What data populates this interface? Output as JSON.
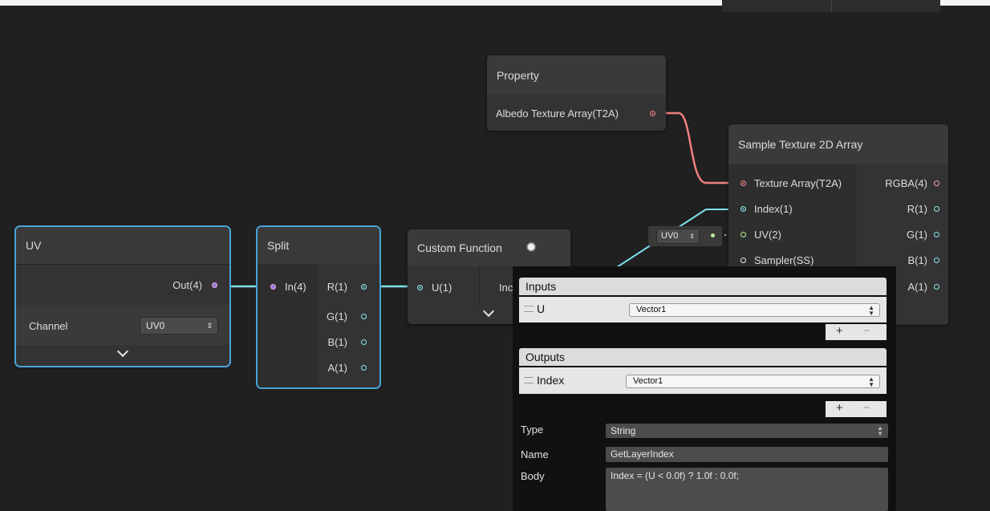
{
  "nodes": {
    "uv": {
      "title": "UV",
      "output": "Out(4)",
      "channel_label": "Channel",
      "channel_value": "UV0"
    },
    "split": {
      "title": "Split",
      "input": "In(4)",
      "outputs": [
        "R(1)",
        "G(1)",
        "B(1)",
        "A(1)"
      ]
    },
    "custom_function": {
      "title": "Custom Function",
      "input": "U(1)",
      "output_partial": "Inc"
    },
    "property": {
      "title": "Property",
      "output": "Albedo Texture Array(T2A)"
    },
    "sample": {
      "title": "Sample Texture 2D Array",
      "inputs": [
        "Texture Array(T2A)",
        "Index(1)",
        "UV(2)",
        "Sampler(SS)"
      ],
      "outputs": [
        "RGBA(4)",
        "R(1)",
        "G(1)",
        "B(1)",
        "A(1)"
      ],
      "uv_dropdown": "UV0"
    }
  },
  "panel": {
    "inputs_header": "Inputs",
    "input_name": "U",
    "input_type": "Vector1",
    "outputs_header": "Outputs",
    "output_name": "Index",
    "output_type": "Vector1",
    "plus": "+",
    "minus": "−",
    "type_label": "Type",
    "type_value": "String",
    "name_label": "Name",
    "name_value": "GetLayerIndex",
    "body_label": "Body",
    "body_value": "Index = (U < 0.0f) ? 1.0f : 0.0f;"
  },
  "colors": {
    "background": "#202020",
    "node": "#333333",
    "selection": "#4aa3d9",
    "wire_cyan": "#7fe0ee",
    "wire_red": "#f08080"
  }
}
